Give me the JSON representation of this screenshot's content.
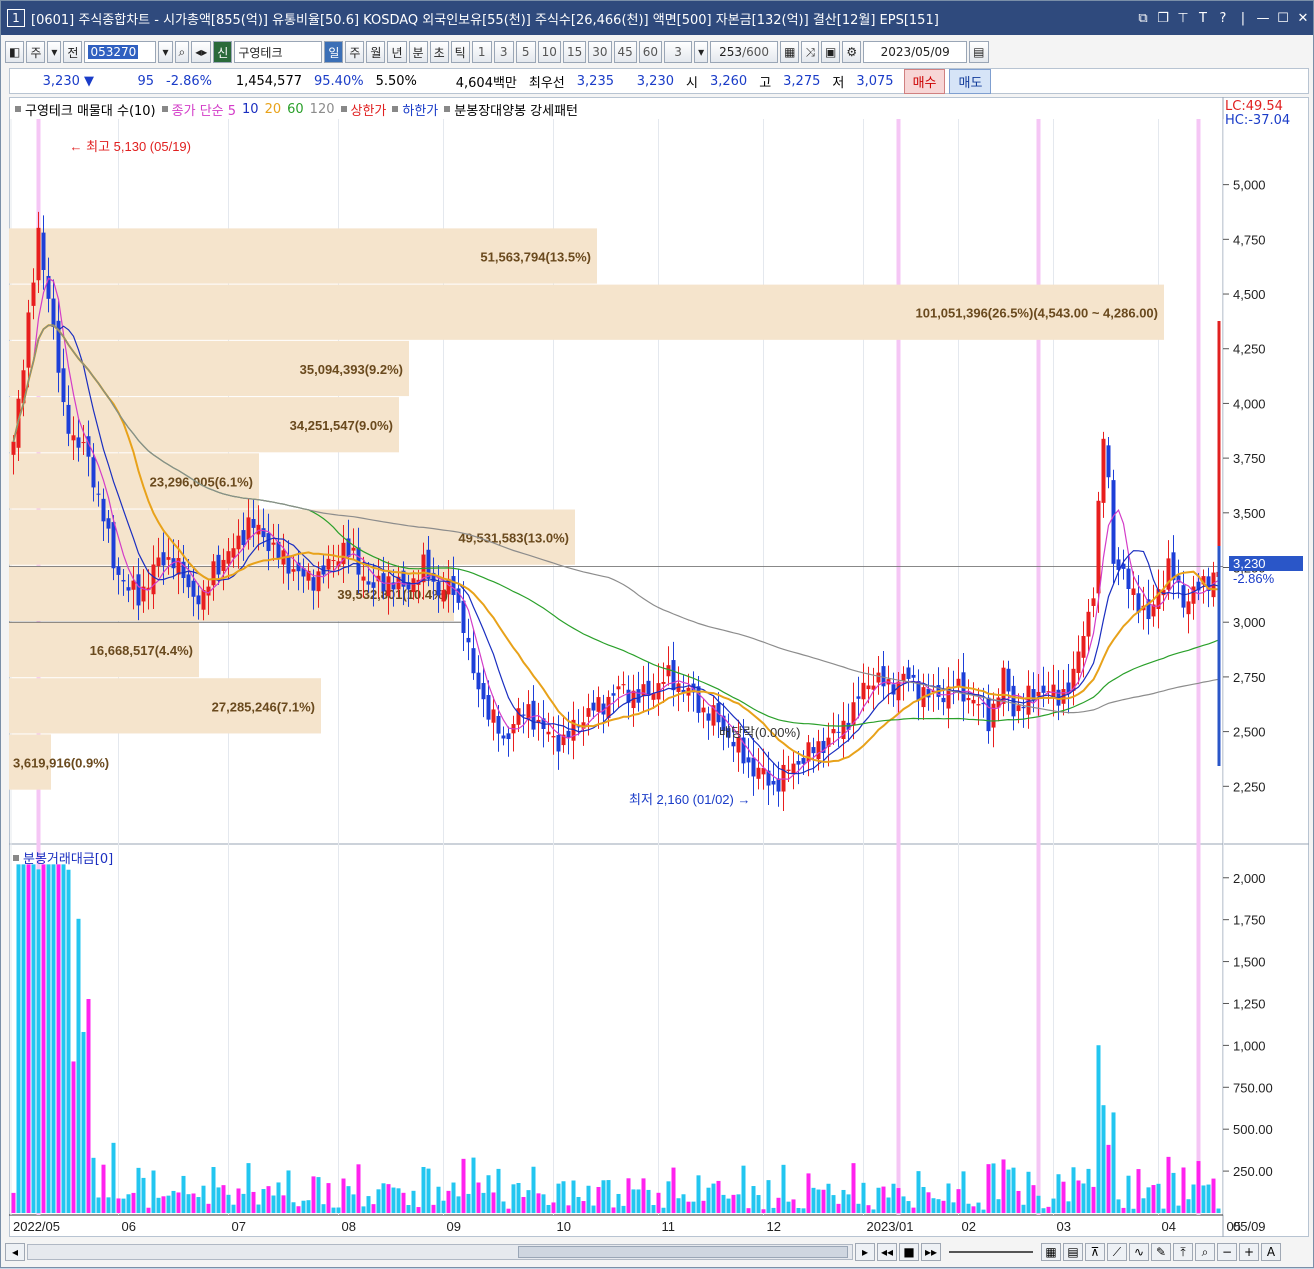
{
  "window": {
    "number": "1",
    "title": "[0601] 주식종합차트 - 시가총액[855(억)] 유통비율[50.6] KOSDAQ 외국인보유[55(천)] 주식수[26,466(천)] 액면[500] 자본금[132(억)] 결산[12월] EPS[151]"
  },
  "toolbar": {
    "market": "주",
    "prev": "전",
    "code": "053270",
    "new_badge": "신",
    "stock_name": "구영테크",
    "periods": [
      "일",
      "주",
      "월",
      "년",
      "분",
      "초",
      "틱"
    ],
    "selected_period": "일",
    "intervals": [
      "1",
      "3",
      "5",
      "10",
      "15",
      "30",
      "45",
      "60"
    ],
    "interval_value": "3",
    "count": "253",
    "count_total": "/600",
    "date": "2023/05/09"
  },
  "quote": {
    "price": "3,230 ▼",
    "change": "95",
    "change_pct": "-2.86%",
    "volume": "1,454,577",
    "ratio1": "95.40%",
    "ratio2": "5.50%",
    "amount": "4,604백만",
    "best_label": "최우선",
    "best_ask": "3,235",
    "best_bid": "3,230",
    "open_label": "시",
    "open": "3,260",
    "high_label": "고",
    "high": "3,275",
    "low_label": "저",
    "low": "3,075",
    "buy_button": "매수",
    "sell_button": "매도"
  },
  "legend": {
    "title": "구영테크 매물대 수(10)",
    "ma_label": "종가 단순 5",
    "ma10": "10",
    "ma20": "20",
    "ma60": "60",
    "ma120": "120",
    "upper_limit": "상한가",
    "lower_limit": "하한가",
    "pattern": "분봉장대양봉 강세패턴"
  },
  "lc": "LC:49.54",
  "hc": "HC:-37.04",
  "volume_legend": "분봉거래대금[0]",
  "annotations": {
    "high": "최고 5,130 (05/19)",
    "low": "최저 2,160 (01/02)",
    "div": "배당락(0.00%)"
  },
  "current_price_tag": "3,230",
  "current_change_tag": "-2.86%",
  "colors": {
    "up": "#e81e1e",
    "down": "#1d3fd8",
    "ma5": "#d33cc8",
    "ma10": "#1a2ec0",
    "ma20": "#e8a21a",
    "ma60": "#2aa02a",
    "ma120": "#8c8c8c",
    "profile": "#f5e4cc",
    "vol_a": "#ff22ee",
    "vol_b": "#22c6f0",
    "highlight": "#f5c6f5"
  },
  "chart_data": [
    {
      "type": "candlestick",
      "title": "구영테크",
      "y_axis_ticks": [
        "5,000",
        "4,750",
        "4,500",
        "4,250",
        "4,000",
        "3,750",
        "3,500",
        "3,250",
        "3,000",
        "2,750",
        "2,500",
        "2,250"
      ],
      "ylim": [
        2000,
        5300
      ],
      "x_axis_ticks": [
        "2022/05",
        "06",
        "07",
        "08",
        "09",
        "10",
        "11",
        "12",
        "2023/01",
        "02",
        "03",
        "04",
        "05",
        "05/09"
      ],
      "close_series": [
        [
          0,
          3800
        ],
        [
          3,
          4400
        ],
        [
          5,
          4750
        ],
        [
          7,
          4500
        ],
        [
          8,
          4350
        ],
        [
          10,
          3950
        ],
        [
          12,
          3850
        ],
        [
          14,
          3800
        ],
        [
          16,
          3650
        ],
        [
          18,
          3500
        ],
        [
          20,
          3250
        ],
        [
          22,
          3200
        ],
        [
          25,
          3100
        ],
        [
          28,
          3250
        ],
        [
          32,
          3300
        ],
        [
          35,
          3150
        ],
        [
          38,
          3100
        ],
        [
          40,
          3250
        ],
        [
          43,
          3300
        ],
        [
          47,
          3450
        ],
        [
          50,
          3400
        ],
        [
          53,
          3300
        ],
        [
          56,
          3250
        ],
        [
          58,
          3200
        ],
        [
          60,
          3200
        ],
        [
          63,
          3250
        ],
        [
          66,
          3350
        ],
        [
          69,
          3250
        ],
        [
          72,
          3150
        ],
        [
          75,
          3200
        ],
        [
          78,
          3150
        ],
        [
          82,
          3250
        ],
        [
          85,
          3150
        ],
        [
          88,
          3150
        ],
        [
          90,
          3000
        ],
        [
          92,
          2750
        ],
        [
          95,
          2600
        ],
        [
          98,
          2450
        ],
        [
          100,
          2550
        ],
        [
          103,
          2600
        ],
        [
          106,
          2500
        ],
        [
          110,
          2450
        ],
        [
          113,
          2550
        ],
        [
          116,
          2600
        ],
        [
          119,
          2650
        ],
        [
          122,
          2700
        ],
        [
          125,
          2650
        ],
        [
          128,
          2700
        ],
        [
          131,
          2750
        ],
        [
          134,
          2700
        ],
        [
          136,
          2650
        ],
        [
          138,
          2600
        ],
        [
          141,
          2550
        ],
        [
          144,
          2450
        ],
        [
          147,
          2350
        ],
        [
          150,
          2300
        ],
        [
          152,
          2250
        ],
        [
          154,
          2300
        ],
        [
          156,
          2350
        ],
        [
          159,
          2400
        ],
        [
          162,
          2450
        ],
        [
          165,
          2500
        ],
        [
          168,
          2600
        ],
        [
          170,
          2700
        ],
        [
          172,
          2750
        ],
        [
          175,
          2700
        ],
        [
          178,
          2750
        ],
        [
          181,
          2700
        ],
        [
          184,
          2650
        ],
        [
          188,
          2700
        ],
        [
          192,
          2650
        ],
        [
          195,
          2550
        ],
        [
          198,
          2750
        ],
        [
          200,
          2600
        ],
        [
          203,
          2650
        ],
        [
          206,
          2700
        ],
        [
          209,
          2650
        ],
        [
          212,
          2750
        ],
        [
          214,
          2950
        ],
        [
          216,
          3150
        ],
        [
          218,
          3850
        ],
        [
          219,
          3650
        ],
        [
          220,
          3300
        ],
        [
          222,
          3200
        ],
        [
          225,
          3100
        ],
        [
          227,
          3000
        ],
        [
          229,
          3150
        ],
        [
          231,
          3250
        ],
        [
          234,
          3100
        ],
        [
          237,
          3150
        ],
        [
          239,
          3200
        ],
        [
          241,
          3230
        ]
      ],
      "volume_profile": [
        {
          "label": "51,563,794(13.5%)"
        },
        {
          "label": "101,051,396(26.5%)(4,543.00 ~ 4,286.00)"
        },
        {
          "label": "35,094,393(9.2%)"
        },
        {
          "label": "34,251,547(9.0%)"
        },
        {
          "label": "23,296,005(6.1%)"
        },
        {
          "label": "49,531,583(13.0%)"
        },
        {
          "label": "39,532,801(10.4%)"
        },
        {
          "label": "16,668,517(4.4%)"
        },
        {
          "label": "27,285,246(7.1%)"
        },
        {
          "label": "3,619,916(0.9%)"
        }
      ]
    },
    {
      "type": "bar",
      "title": "분봉거래대금[0]",
      "y_axis_ticks": [
        "2,000",
        "1,750",
        "1,500",
        "1,250",
        "1,000",
        "750.00",
        "500.00",
        "250.00"
      ],
      "ylim": [
        0,
        2100
      ]
    }
  ]
}
